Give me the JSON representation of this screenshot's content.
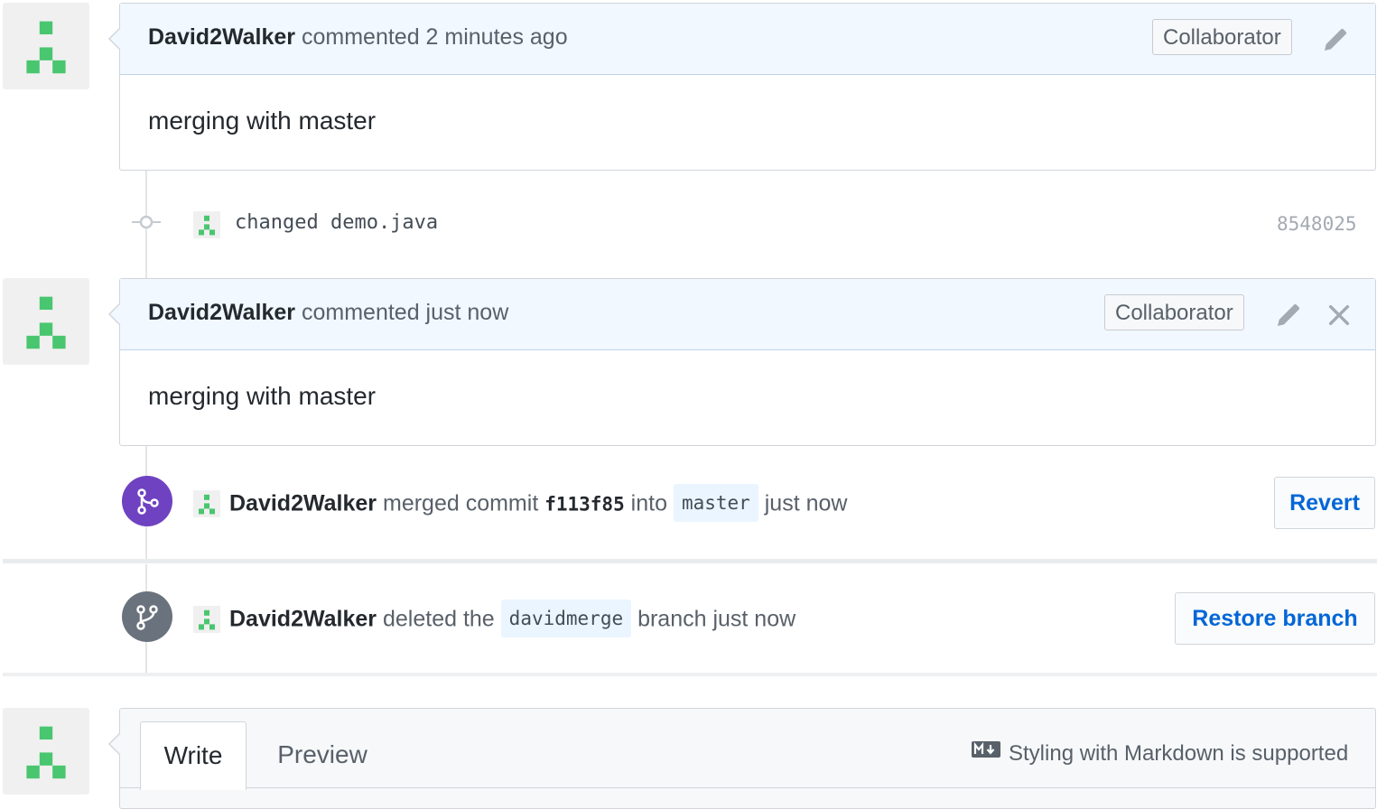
{
  "comments": [
    {
      "author": "David2Walker",
      "action": " commented 2 minutes ago",
      "role_badge": "Collaborator",
      "body": "merging with master",
      "tools": [
        "pencil-icon"
      ]
    },
    {
      "author": "David2Walker",
      "action": " commented just now",
      "role_badge": "Collaborator",
      "body": "merging with master",
      "tools": [
        "pencil-icon",
        "close-icon"
      ]
    }
  ],
  "commit_event": {
    "message": "changed demo.java",
    "sha": "8548025"
  },
  "merge_event": {
    "author": "David2Walker",
    "text_before": " merged commit ",
    "commit": "f113f85",
    "text_mid": " into ",
    "branch": "master",
    "text_after": " just now",
    "button": "Revert"
  },
  "delete_event": {
    "author": "David2Walker",
    "text_before": " deleted the ",
    "branch": "davidmerge",
    "text_after": " branch just now",
    "button": "Restore branch"
  },
  "editor": {
    "tabs": [
      "Write",
      "Preview"
    ],
    "active_tab": "Write",
    "markdown_note": "Styling with Markdown is supported",
    "markdown_icon": "markdown-icon"
  },
  "colors": {
    "identicon": "#49c66f",
    "merge_badge": "#6f42c1",
    "delete_badge": "#6a737d",
    "link": "#0366d6",
    "comment_header": "#f1f8ff"
  }
}
